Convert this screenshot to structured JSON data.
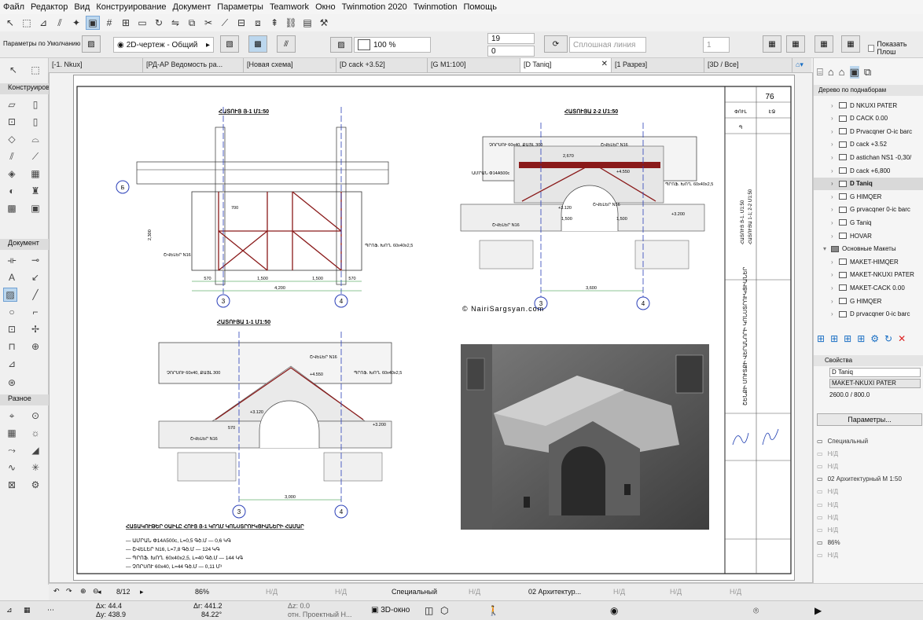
{
  "menu": [
    "Файл",
    "Редактор",
    "Вид",
    "Конструирование",
    "Документ",
    "Параметры",
    "Teamwork",
    "Окно",
    "Twinmotion 2020",
    "Twinmotion",
    "Помощь"
  ],
  "toolbar2": {
    "defaults_label": "Параметры по Умолчанию",
    "view_type": "2D-чертеж - Общий",
    "scale_pct": "100 %",
    "field_a": "19",
    "field_b": "0",
    "line_type": "Сплошная линия",
    "field_c": "1",
    "show_floor_label": "Показать Плош"
  },
  "tabs": [
    {
      "label": "[-1. Nkux]"
    },
    {
      "label": "[РД-АР Ведомость ра..."
    },
    {
      "label": "[Новая схема]"
    },
    {
      "label": "[D cack +3.52]"
    },
    {
      "label": "[G M1:100]"
    },
    {
      "label": "[D Taniq]"
    },
    {
      "label": "[1 Разрез]"
    },
    {
      "label": "[3D / Все]"
    }
  ],
  "toolbox": {
    "section1": "Конструиров",
    "section2": "Документ",
    "section3": "Разное"
  },
  "drawing": {
    "sheet_number": "76",
    "title_a": "ՀԱՏՈՒՅ Յ-1 Մ1:50",
    "title_b": "ՀԱՏՈՒՅԱ 2-2 Մ1:50",
    "title_c": "ՀԱՏՈՒՅԱ 1-1 Մ1:50",
    "watermark": "© NairiSargsyan.com",
    "axis_3": "3",
    "axis_4": "4",
    "axis_b": "Б",
    "dim_total_a": "4,200",
    "dim_total_b": "3,600",
    "dim_total_c": "3,000",
    "dim_1500": "1,500",
    "dim_570": "570",
    "dim_700": "700",
    "dim_2300": "2,300",
    "dim_2670": "2,670",
    "dim_3120": "+3.120",
    "dim_3200": "+3.200",
    "dim_4550": "+4.550",
    "label_steel": "ՇՎԵԼԵՐ N16",
    "label_pipe": "ՊՐՈՖ. ԽՈՂ. 60x40x2,5",
    "label_beam": "ՉՈՐՍՈՒ 60x40, ՔԱՅԼ 300",
    "label_armature": "ԱՄՐԱՆ Փ14A500c",
    "spec_title": "ՀԱՏԱԿՈՒԹԵՐ ՕԱԻԼԸ ՀՈՒՅ Յ-1 ԿՈՂՄ ԿՈՆՍՏՐՈՒԿՑԻԱՆԵՐԻ ՀԱՄԱՐ",
    "spec_lines": [
      "— ԱՄՐԱՆ Փ14A500c,   L=0,5 Գծ.Մ  — 0,6 ԿԳ",
      "— ՇՎԵԼԵՐ N16,   L=7,8 Գծ.Մ  — 124 ԿԳ",
      "— ՊՐՈՖ. ԽՈՂ. 60x40x2,5,   L=40 Գծ.Մ  — 144 ԿԳ",
      "— ՉՈՐՍՈՒ 60x40,   L=44 Գծ.Մ  — 0,11 Մ³"
    ],
    "stamp_a": "ՓՈՒԼ",
    "stamp_b": "ԷՋ",
    "stamp_c": "Պ",
    "stamp_d": "ՀԱՏՈՒՅ Յ-1. Մ1:50",
    "stamp_e": "ՀԱՏՈՒՅԱ 1-1; 2-2 Մ1:50",
    "stamp_f": "ՇԵՆՔԻ ՄՈՒՏՔԻ ՎԵՐԱՆՈՐԻ ԿՈՆՍՏՐՈՒԿՑԻԱՆԵՐ"
  },
  "rpanel": {
    "tree_header": "Дерево по поднаборам",
    "items": [
      {
        "label": "D NKUXI PATER"
      },
      {
        "label": "D CACK 0.00"
      },
      {
        "label": "D Prvacqner O-ic barc"
      },
      {
        "label": "D cack +3.52"
      },
      {
        "label": "D astichan NS1 -0,30/"
      },
      {
        "label": "D cack +6,800"
      },
      {
        "label": "D Taniq"
      },
      {
        "label": "G HIMQER"
      },
      {
        "label": "G prvacqner 0-ic barc"
      },
      {
        "label": "G Taniq"
      },
      {
        "label": "HOVAR"
      },
      {
        "label": "Основные Макеты"
      },
      {
        "label": "MAKET-HIMQER"
      },
      {
        "label": "MAKET-NKUXI PATER"
      },
      {
        "label": "MAKET-CACK 0.00"
      },
      {
        "label": "G HIMQER"
      },
      {
        "label": "D prvacqner 0-ic barc"
      }
    ],
    "props_header": "Свойства",
    "prop_name": "D Taniq",
    "prop_layout": "MAKET-NKUXI PATER",
    "prop_size": "2600.0 / 800.0",
    "params_button": "Параметры...",
    "props": [
      {
        "label": "Специальный",
        "dim": false
      },
      {
        "label": "Н/Д",
        "dim": true
      },
      {
        "label": "Н/Д",
        "dim": true
      },
      {
        "label": "02 Архитектурный М 1:50",
        "dim": false
      },
      {
        "label": "Н/Д",
        "dim": true
      },
      {
        "label": "Н/Д",
        "dim": true
      },
      {
        "label": "Н/Д",
        "dim": true
      },
      {
        "label": "Н/Д",
        "dim": true
      },
      {
        "label": "86%",
        "dim": false
      },
      {
        "label": "Н/Д",
        "dim": true
      }
    ]
  },
  "statusbar": {
    "page": "8/12",
    "zoom": "86%",
    "nd1": "Н/Д",
    "nd2": "Н/Д",
    "special": "Специальный",
    "nd3": "Н/Д",
    "arch": "02 Архитектур...",
    "nd4": "Н/Д",
    "nd5": "Н/Д",
    "nd6": "Н/Д"
  },
  "coords": {
    "dx": "Δx: 44.4",
    "dy": "Δy: 438.9",
    "dr": "Δr: 441.2",
    "angle": "84.22°",
    "dz": "Δz: 0.0",
    "ref": "отн. Проектный Н...",
    "view3d": "3D-окно"
  }
}
